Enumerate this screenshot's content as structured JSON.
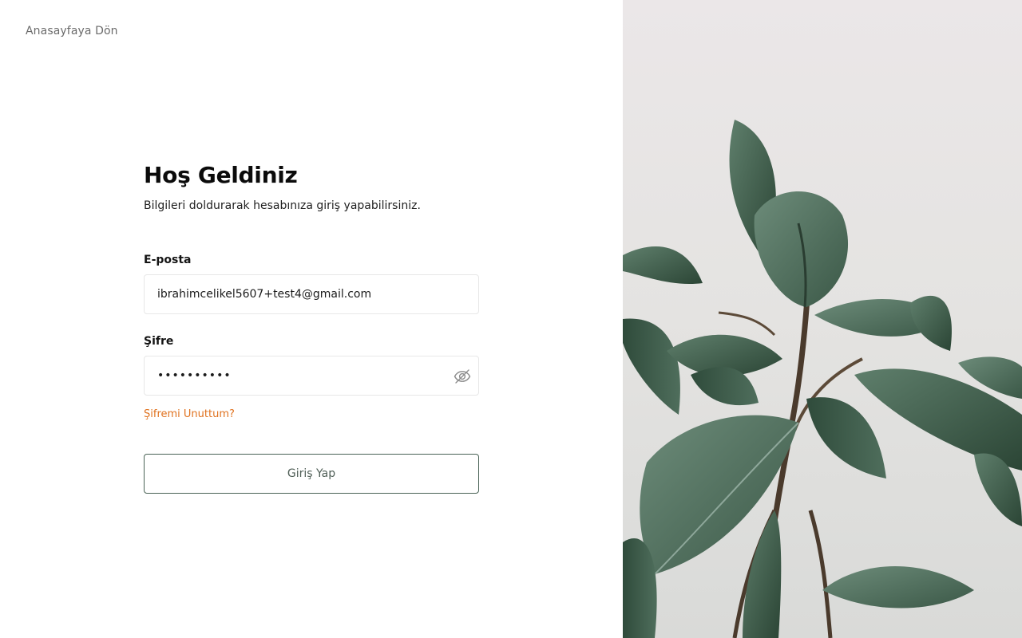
{
  "nav": {
    "back_label": "Anasayfaya Dön"
  },
  "login": {
    "title": "Hoş Geldiniz",
    "subtitle": "Bilgileri doldurarak hesabınıza giriş yapabilirsiniz.",
    "email_label": "E-posta",
    "email_value": "ibrahimcelikel5607+test4@gmail.com",
    "password_label": "Şifre",
    "password_value": "••••••••••",
    "forgot_label": "Şifremi Unuttum?",
    "submit_label": "Giriş Yap"
  },
  "icons": {
    "password_toggle": "eye-off-icon"
  },
  "colors": {
    "accent_orange": "#e0721f",
    "button_border": "#4a6356",
    "plant_dark": "#2f4a3a",
    "plant_mid": "#4d6b5a",
    "background_panel": "#e8e6e5"
  }
}
